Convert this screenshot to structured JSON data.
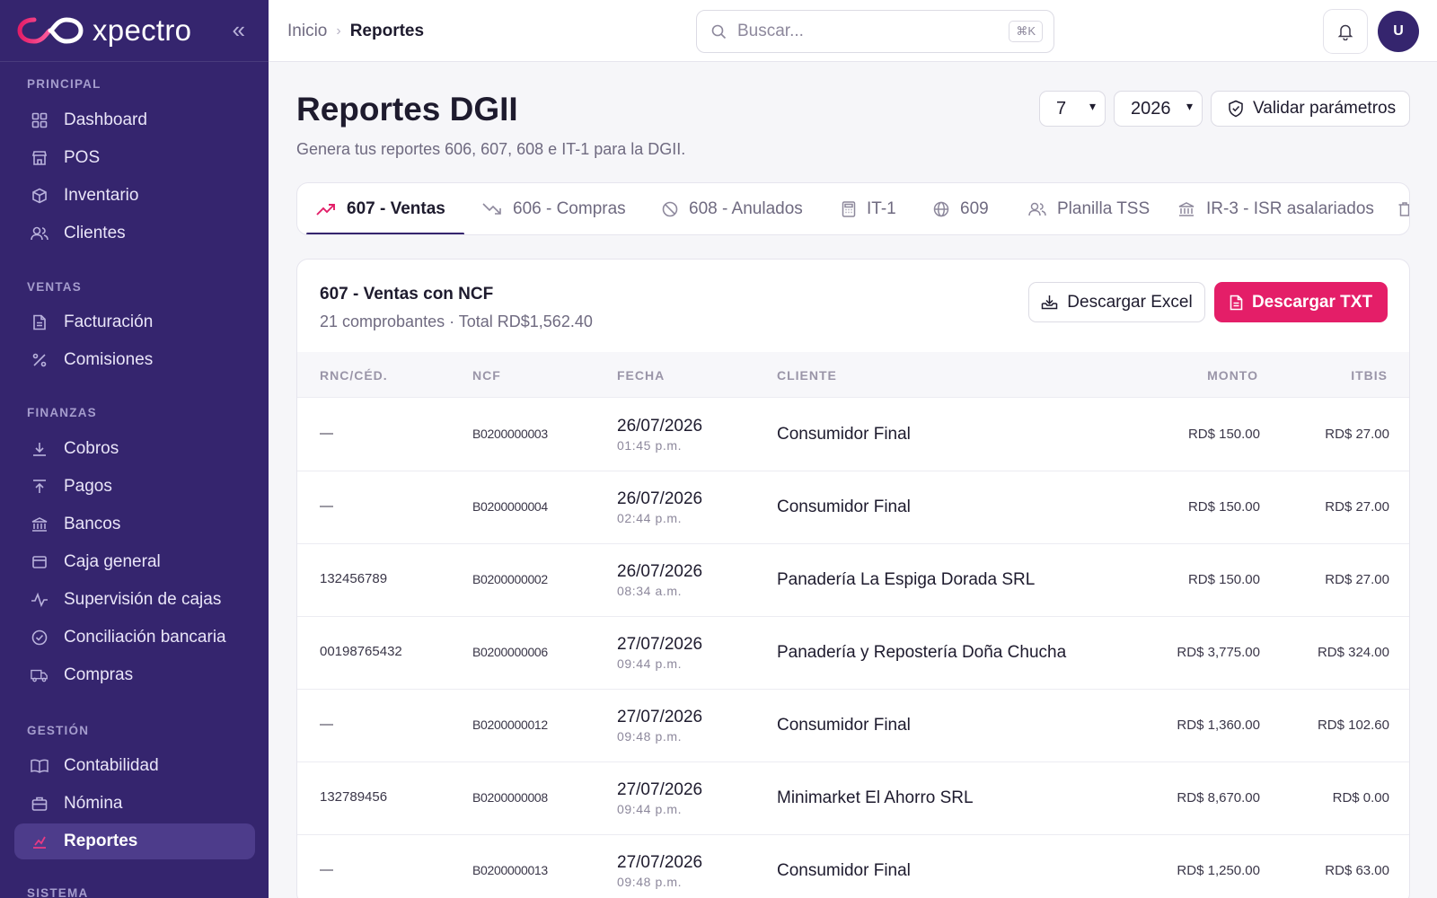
{
  "app": {
    "brand": "xpectro",
    "collapse_icon": "double-chevron-left-icon"
  },
  "sidebar": {
    "sections": [
      {
        "label": "PRINCIPAL",
        "items": [
          {
            "label": "Dashboard",
            "icon": "grid-icon"
          },
          {
            "label": "POS",
            "icon": "store-icon"
          },
          {
            "label": "Inventario",
            "icon": "box-icon"
          },
          {
            "label": "Clientes",
            "icon": "users-icon"
          }
        ]
      },
      {
        "label": "VENTAS",
        "items": [
          {
            "label": "Facturación",
            "icon": "document-icon"
          },
          {
            "label": "Comisiones",
            "icon": "percent-icon"
          }
        ]
      },
      {
        "label": "FINANZAS",
        "items": [
          {
            "label": "Cobros",
            "icon": "download-icon"
          },
          {
            "label": "Pagos",
            "icon": "upload-icon"
          },
          {
            "label": "Bancos",
            "icon": "bank-icon"
          },
          {
            "label": "Caja general",
            "icon": "cash-box-icon"
          },
          {
            "label": "Supervisión de cajas",
            "icon": "activity-icon"
          },
          {
            "label": "Conciliación bancaria",
            "icon": "check-circle-icon"
          },
          {
            "label": "Compras",
            "icon": "truck-icon"
          }
        ]
      },
      {
        "label": "GESTIÓN",
        "items": [
          {
            "label": "Contabilidad",
            "icon": "book-icon"
          },
          {
            "label": "Nómina",
            "icon": "briefcase-icon"
          },
          {
            "label": "Reportes",
            "icon": "chart-icon",
            "active": true
          }
        ]
      },
      {
        "label": "SISTEMA",
        "items": []
      }
    ]
  },
  "topbar": {
    "breadcrumb": [
      "Inicio",
      "Reportes"
    ],
    "search": {
      "placeholder": "Buscar...",
      "shortcut": "⌘K"
    },
    "avatar_initial": "U"
  },
  "page": {
    "title": "Reportes DGII",
    "subtitle": "Genera tus reportes 606, 607, 608 e IT-1 para la DGII.",
    "month": "7",
    "year": "2026",
    "validate_label": "Validar parámetros"
  },
  "tabs": [
    {
      "label": "607 - Ventas",
      "icon": "trending-up-icon",
      "active": true
    },
    {
      "label": "606 - Compras",
      "icon": "trending-down-icon"
    },
    {
      "label": "608 - Anulados",
      "icon": "ban-icon"
    },
    {
      "label": "IT-1",
      "icon": "calculator-icon"
    },
    {
      "label": "609",
      "icon": "globe-icon"
    },
    {
      "label": "Planilla TSS",
      "icon": "users-icon"
    },
    {
      "label": "IR-3 - ISR asalariados",
      "icon": "bank-icon"
    }
  ],
  "report": {
    "title": "607 - Ventas con NCF",
    "summary": "21 comprobantes · Total RD$1,562.40",
    "excel_label": "Descargar Excel",
    "txt_label": "Descargar TXT",
    "accent": "#e41e68",
    "columns": [
      "RNC/CÉD.",
      "NCF",
      "FECHA",
      "CLIENTE",
      "MONTO",
      "ITBIS"
    ],
    "rows": [
      {
        "rnc": "—",
        "ncf": "B0200000003",
        "date": "26/07/2026",
        "time": "01:45 p.m.",
        "client": "Consumidor Final",
        "monto": "RD$ 150.00",
        "itbis": "RD$ 27.00"
      },
      {
        "rnc": "—",
        "ncf": "B0200000004",
        "date": "26/07/2026",
        "time": "02:44 p.m.",
        "client": "Consumidor Final",
        "monto": "RD$ 150.00",
        "itbis": "RD$ 27.00"
      },
      {
        "rnc": "132456789",
        "ncf": "B0200000002",
        "date": "26/07/2026",
        "time": "08:34 a.m.",
        "client": "Panadería La Espiga Dorada SRL",
        "monto": "RD$ 150.00",
        "itbis": "RD$ 27.00"
      },
      {
        "rnc": "00198765432",
        "ncf": "B0200000006",
        "date": "27/07/2026",
        "time": "09:44 p.m.",
        "client": "Panadería y Repostería Doña Chucha",
        "monto": "RD$ 3,775.00",
        "itbis": "RD$ 324.00"
      },
      {
        "rnc": "—",
        "ncf": "B0200000012",
        "date": "27/07/2026",
        "time": "09:48 p.m.",
        "client": "Consumidor Final",
        "monto": "RD$ 1,360.00",
        "itbis": "RD$ 102.60"
      },
      {
        "rnc": "132789456",
        "ncf": "B0200000008",
        "date": "27/07/2026",
        "time": "09:44 p.m.",
        "client": "Minimarket El Ahorro SRL",
        "monto": "RD$ 8,670.00",
        "itbis": "RD$ 0.00"
      },
      {
        "rnc": "—",
        "ncf": "B0200000013",
        "date": "27/07/2026",
        "time": "09:48 p.m.",
        "client": "Consumidor Final",
        "monto": "RD$ 1,250.00",
        "itbis": "RD$ 63.00"
      }
    ]
  },
  "colors": {
    "sidebar_bg": "#35256e",
    "accent_pink": "#e41e68"
  }
}
